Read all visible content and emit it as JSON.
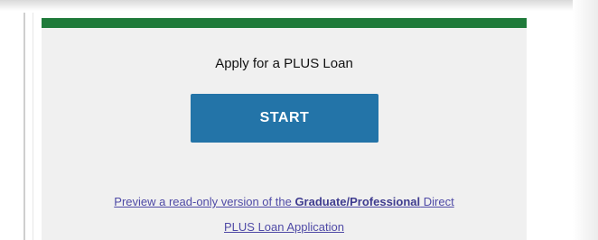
{
  "heading": "Apply for a PLUS Loan",
  "start_button": "START",
  "preview_link": {
    "part1": "Preview a read-only version of the ",
    "bold": "Graduate/Professional",
    "part2": " Direct",
    "line2": "PLUS Loan Application"
  },
  "colors": {
    "accent_bar": "#1f7a3a",
    "button": "#2374a8",
    "link": "#4f4aa6"
  }
}
